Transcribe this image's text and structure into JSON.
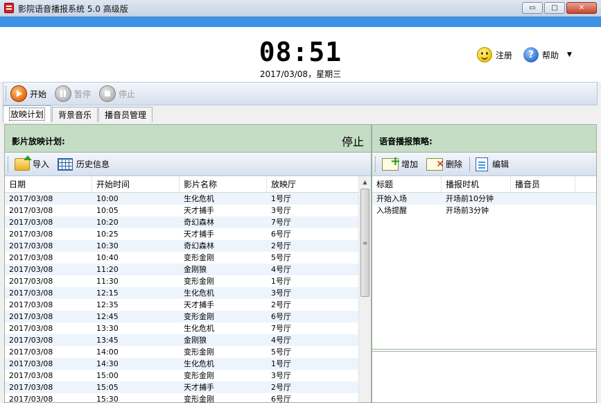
{
  "window": {
    "title": "影院语音播报系统 5.0 高级版",
    "buttons": [
      "▭",
      "□",
      "✕"
    ]
  },
  "header": {
    "clock": "08:51",
    "date": "2017/03/08，星期三",
    "register": "注册",
    "help": "帮助",
    "help_glyph": "?",
    "caret": "▼"
  },
  "playbar": {
    "start": "开始",
    "pause": "暂停",
    "stop": "停止"
  },
  "tabs": [
    "放映计划",
    "背景音乐",
    "播音员管理"
  ],
  "left": {
    "title": "影片放映计划:",
    "status": "停止",
    "toolbar": {
      "import": "导入",
      "history": "历史信息"
    },
    "columns": [
      "日期",
      "开始时间",
      "影片名称",
      "放映厅"
    ],
    "rows": [
      [
        "2017/03/08",
        "10:00",
        "生化危机",
        "1号厅"
      ],
      [
        "2017/03/08",
        "10:05",
        "天才捕手",
        "3号厅"
      ],
      [
        "2017/03/08",
        "10:20",
        "奇幻森林",
        "7号厅"
      ],
      [
        "2017/03/08",
        "10:25",
        "天才捕手",
        "6号厅"
      ],
      [
        "2017/03/08",
        "10:30",
        "奇幻森林",
        "2号厅"
      ],
      [
        "2017/03/08",
        "10:40",
        "变形金刚",
        "5号厅"
      ],
      [
        "2017/03/08",
        "11:20",
        "金刚狼",
        "4号厅"
      ],
      [
        "2017/03/08",
        "11:30",
        "变形金刚",
        "1号厅"
      ],
      [
        "2017/03/08",
        "12:15",
        "生化危机",
        "3号厅"
      ],
      [
        "2017/03/08",
        "12:35",
        "天才捕手",
        "2号厅"
      ],
      [
        "2017/03/08",
        "12:45",
        "变形金刚",
        "6号厅"
      ],
      [
        "2017/03/08",
        "13:30",
        "生化危机",
        "7号厅"
      ],
      [
        "2017/03/08",
        "13:45",
        "金刚狼",
        "4号厅"
      ],
      [
        "2017/03/08",
        "14:00",
        "变形金刚",
        "5号厅"
      ],
      [
        "2017/03/08",
        "14:30",
        "生化危机",
        "1号厅"
      ],
      [
        "2017/03/08",
        "15:00",
        "变形金刚",
        "3号厅"
      ],
      [
        "2017/03/08",
        "15:05",
        "天才捕手",
        "2号厅"
      ],
      [
        "2017/03/08",
        "15:30",
        "变形金刚",
        "6号厅"
      ]
    ]
  },
  "right": {
    "title": "语音播报策略:",
    "toolbar": {
      "add": "增加",
      "delete": "删除",
      "edit": "编辑"
    },
    "columns": [
      "标题",
      "播报时机",
      "播音员"
    ],
    "rows": [
      [
        "开始入场",
        "开场前10分钟",
        ""
      ],
      [
        "入场提醒",
        "开场前3分钟",
        ""
      ]
    ]
  }
}
